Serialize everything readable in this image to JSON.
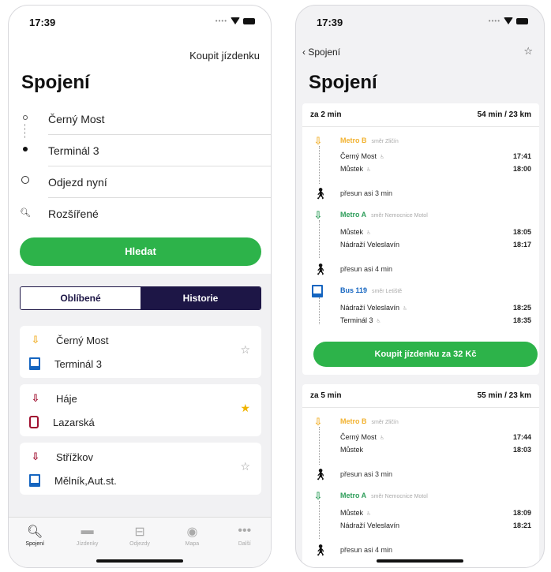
{
  "left": {
    "status_time": "17:39",
    "buy_link": "Koupit jízdenku",
    "title": "Spojení",
    "form": {
      "from": "Černý Most",
      "to": "Terminál 3",
      "departure": "Odjezd nyní",
      "advanced": "Rozšířené"
    },
    "search_button": "Hledat",
    "segments": {
      "favorites": "Oblíbené",
      "history": "Historie"
    },
    "favorites": [
      {
        "from": "Černý Most",
        "to": "Terminál 3",
        "starred": false
      },
      {
        "from": "Háje",
        "to": "Lazarská",
        "starred": true
      },
      {
        "from": "Střížkov",
        "to": "Mělník,Aut.st.",
        "starred": false
      }
    ],
    "tabs": [
      "Spojení",
      "Jízdenky",
      "Odjezdy",
      "Mapa",
      "Další"
    ]
  },
  "right": {
    "status_time": "17:39",
    "back_label": "Spojení",
    "title": "Spojení",
    "connections": [
      {
        "in": "za 2 min",
        "summary": "54 min / 23 km",
        "legs": [
          {
            "line": "Metro B",
            "direction": "směr Zličín",
            "stops": [
              {
                "name": "Černý Most",
                "time": "17:41"
              },
              {
                "name": "Můstek",
                "time": "18:00"
              }
            ]
          },
          {
            "walk": "přesun asi 3 min"
          },
          {
            "line": "Metro A",
            "direction": "směr Nemocnice Motol",
            "stops": [
              {
                "name": "Můstek",
                "time": "18:05"
              },
              {
                "name": "Nádraží Veleslavín",
                "time": "18:17"
              }
            ]
          },
          {
            "walk": "přesun asi 4 min"
          },
          {
            "line": "Bus 119",
            "direction": "směr Letiště",
            "stops": [
              {
                "name": "Nádraží Veleslavín",
                "time": "18:25"
              },
              {
                "name": "Terminál 3",
                "time": "18:35"
              }
            ]
          }
        ],
        "buy_label": "Koupit jízdenku za 32 Kč"
      },
      {
        "in": "za 5 min",
        "summary": "55 min / 23 km",
        "legs": [
          {
            "line": "Metro B",
            "direction": "směr Zličín",
            "stops": [
              {
                "name": "Černý Most",
                "time": "17:44"
              },
              {
                "name": "Můstek",
                "time": "18:03"
              }
            ]
          },
          {
            "walk": "přesun asi 3 min"
          },
          {
            "line": "Metro A",
            "direction": "směr Nemocnice Motol",
            "stops": [
              {
                "name": "Můstek",
                "time": "18:09"
              },
              {
                "name": "Nádraží Veleslavín",
                "time": "18:21"
              }
            ]
          },
          {
            "walk": "přesun asi 4 min"
          }
        ]
      }
    ]
  },
  "colors": {
    "green": "#2db34a",
    "navy": "#1d1646",
    "metro_b": "#f2b230",
    "metro_a": "#2f9e5b",
    "bus": "#1565c0",
    "metro_c": "#a01030",
    "star_gold": "#f0b400"
  },
  "icons": {
    "metro": "metro-arrow-icon",
    "bus": "bus-icon",
    "tram": "tram-icon",
    "walk": "walk-icon",
    "star": "star-icon"
  }
}
